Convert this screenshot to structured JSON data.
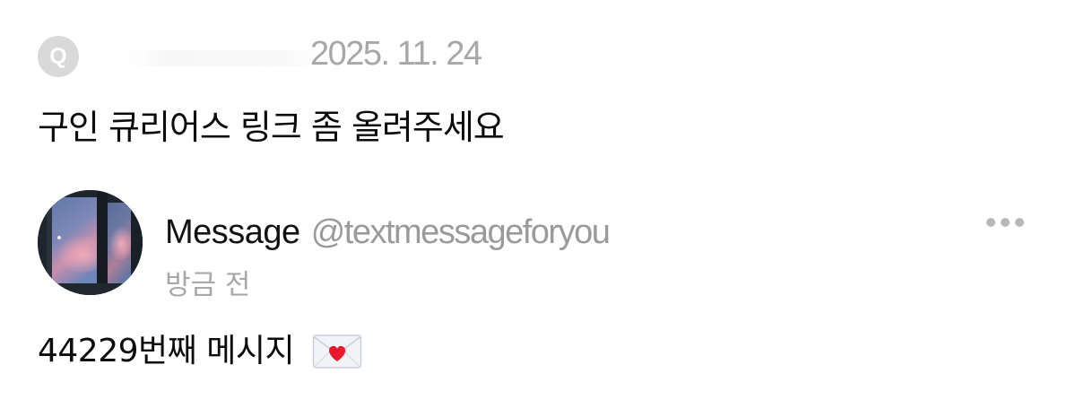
{
  "question": {
    "badge_letter": "Q",
    "date": "2025. 11. 24",
    "text": "구인 큐리어스 링크 좀 올려주세요"
  },
  "answer": {
    "author": {
      "display_name": "Message",
      "handle": "@textmessageforyou",
      "time_ago": "방금 전"
    },
    "text": "44229번째 메시지",
    "emoji": "love-letter-icon"
  },
  "colors": {
    "badge_bg": "#d9d9d9",
    "muted_text": "#a7a7a7",
    "primary_text": "#111111",
    "heart": "#e8192c"
  }
}
